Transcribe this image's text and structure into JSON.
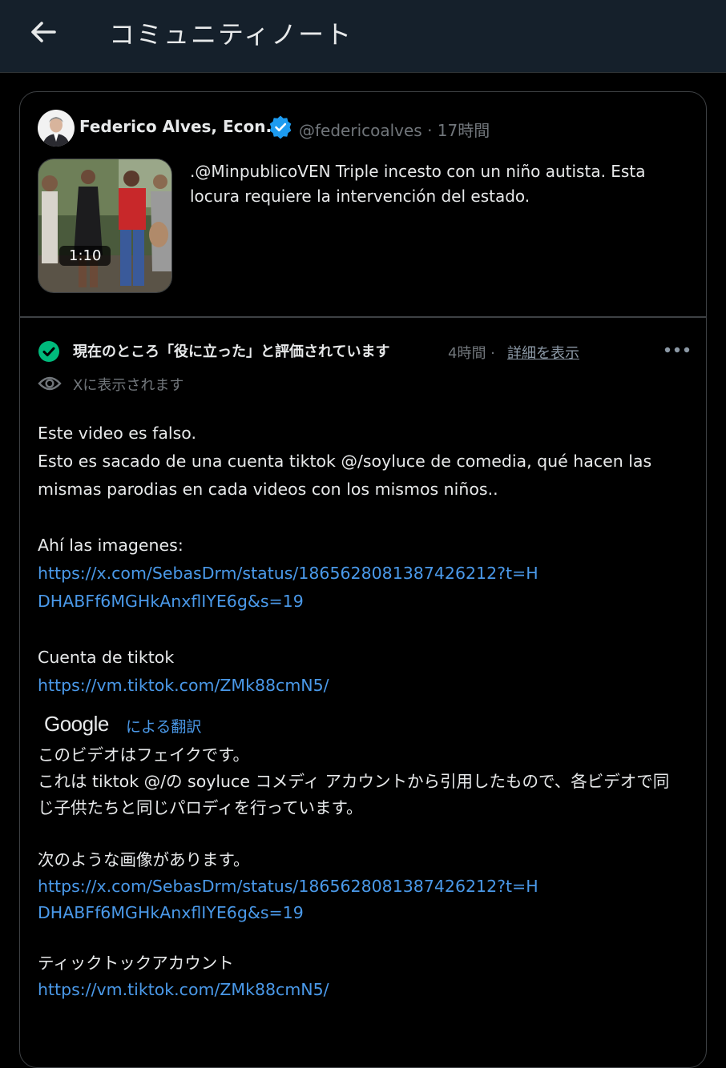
{
  "header": {
    "title": "コミュニティノート"
  },
  "tweet": {
    "author_name": "Federico Alves, Econ.",
    "handle_time": "@federicoalves · 17時間",
    "video_duration": "1:10",
    "text": ".@MinpublicoVEN Triple incesto con un niño autista. Esta locura requiere la intervención del estado."
  },
  "note": {
    "status": "現在のところ「役に立った」と評価されています",
    "time": "4時間 ·",
    "show_details": "詳細を表示",
    "visibility": "Xに表示されます",
    "original": {
      "line1": "Este video es falso.",
      "line2": "Esto es sacado de una cuenta tiktok @/soyluce de comedia, qué hacen las mismas parodias en cada videos con los mismos niños..",
      "images_label": "Ahí las imagenes:",
      "images_link": "https://x.com/SebasDrm/status/1865628081387426212?t=HDHABFf6MGHkAnxflIYE6g&s=19",
      "tiktok_label": "Cuenta de tiktok",
      "tiktok_link": "https://vm.tiktok.com/ZMk88cmN5/"
    },
    "translation": {
      "google": "Google",
      "by": "による翻訳",
      "line1": "このビデオはフェイクです。",
      "line2": "これは tiktok @/の soyluce コメディ アカウントから引用したもので、各ビデオで同じ子供たちと同じパロディを行っています。",
      "images_label": "次のような画像があります。",
      "images_link": "https://x.com/SebasDrm/status/1865628081387426212?t=HDHABFf6MGHkAnxflIYE6g&s=19",
      "tiktok_label": "ティックトックアカウント",
      "tiktok_link": "https://vm.tiktok.com/ZMk88cmN5/"
    }
  },
  "colors": {
    "link": "#4a99e9",
    "verified": "#1d9bf0",
    "helpful": "#00ba7c",
    "header_bg": "#15202b"
  }
}
